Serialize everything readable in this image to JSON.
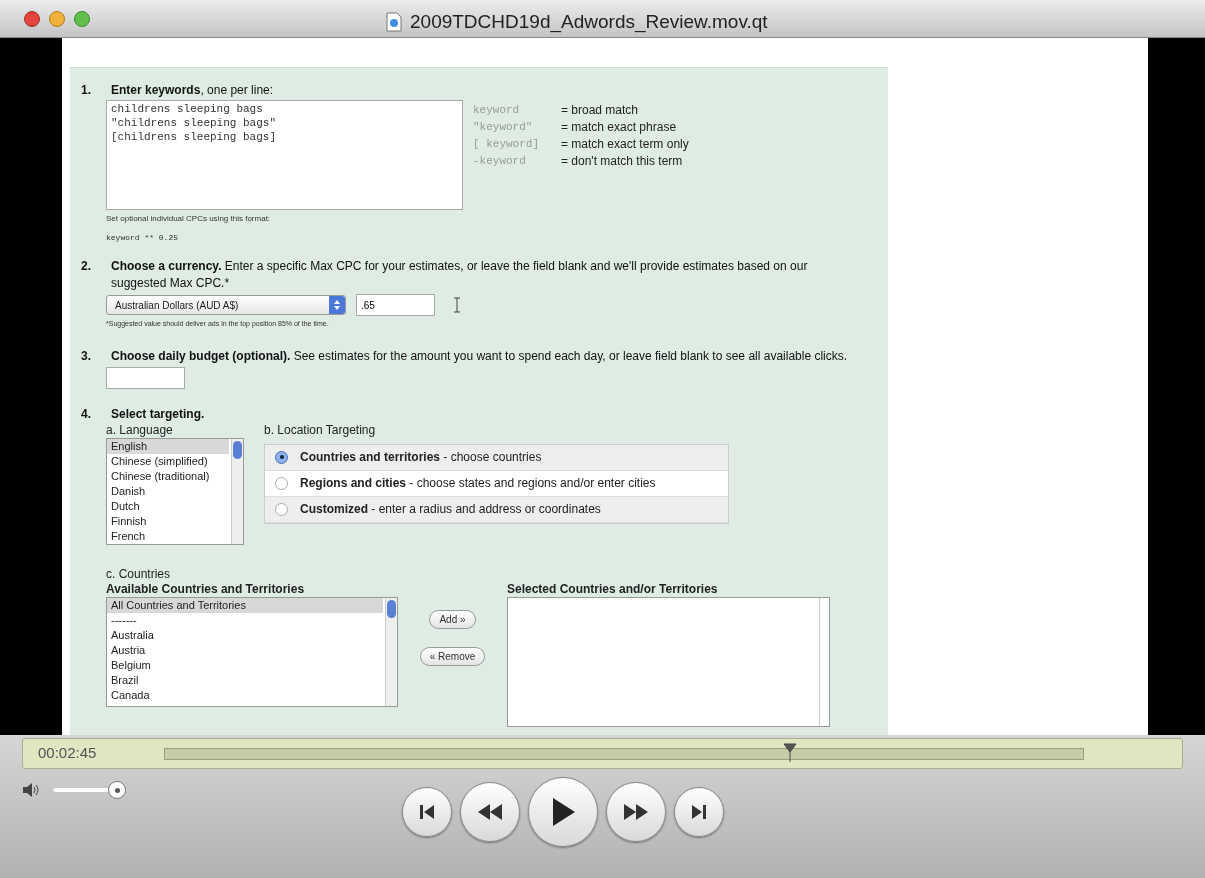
{
  "window": {
    "title": "2009TDCHD19d_Adwords_Review.mov.qt"
  },
  "form": {
    "steps": [
      {
        "number": "1.",
        "title": "Enter keywords",
        "text": ", one per line:"
      },
      {
        "number": "2.",
        "title": "Choose a currency.",
        "text": " Enter a specific Max CPC for your estimates, or leave the field blank and we'll provide estimates based on our suggested Max CPC.*"
      },
      {
        "number": "3.",
        "title": "Choose daily budget (optional).",
        "text": " See estimates for the amount you want to spend each day, or leave field blank to see all available clicks."
      },
      {
        "number": "4.",
        "title": "Select targeting."
      }
    ],
    "keywords": {
      "lines": [
        "childrens sleeping bags",
        "\"childrens sleeping bags\"",
        "[childrens sleeping bags]"
      ],
      "hint": "Set optional individual CPCs using this format:",
      "example": "keyword ** 0.25"
    },
    "legend": [
      {
        "syntax": "keyword",
        "meaning": "= broad match"
      },
      {
        "syntax": "\"keyword\"",
        "meaning": "= match exact phrase"
      },
      {
        "syntax": "[ keyword]",
        "meaning": "= match exact term only"
      },
      {
        "syntax": "-keyword",
        "meaning": "= don't match this term"
      }
    ],
    "currency": {
      "select": "Australian Dollars (AUD A$)",
      "max_cpc": ".65",
      "note": "*Suggested value should deliver ads in the top position 85% of the time."
    },
    "language": {
      "label": "a. Language",
      "items": [
        {
          "label": "English",
          "selected": true
        },
        {
          "label": "Chinese (simplified)",
          "selected": false
        },
        {
          "label": "Chinese (traditional)",
          "selected": false
        },
        {
          "label": "Danish",
          "selected": false
        },
        {
          "label": "Dutch",
          "selected": false
        },
        {
          "label": "Finnish",
          "selected": false
        },
        {
          "label": "French",
          "selected": false
        }
      ]
    },
    "location": {
      "label": "b. Location Targeting",
      "options": [
        {
          "title": "Countries and territories",
          "text": " - choose countries",
          "selected": true
        },
        {
          "title": "Regions and cities",
          "text": " - choose states and regions and/or enter cities",
          "selected": false
        },
        {
          "title": "Customized",
          "text": " - enter a radius and address or coordinates",
          "selected": false
        }
      ]
    },
    "countries": {
      "label": "c. Countries",
      "available_heading": "Available Countries and Territories",
      "selected_heading": "Selected Countries and/or Territories",
      "items": [
        {
          "label": "All Countries and Territories",
          "selected": true
        },
        {
          "label": "-------",
          "selected": false
        },
        {
          "label": "Australia",
          "selected": false
        },
        {
          "label": "Austria",
          "selected": false
        },
        {
          "label": "Belgium",
          "selected": false
        },
        {
          "label": "Brazil",
          "selected": false
        },
        {
          "label": "Canada",
          "selected": false
        }
      ],
      "add_button": "Add »",
      "remove_button": "« Remove"
    }
  },
  "player": {
    "time": "00:02:45",
    "level": 0.68,
    "volume": {
      "level": 1
    }
  }
}
